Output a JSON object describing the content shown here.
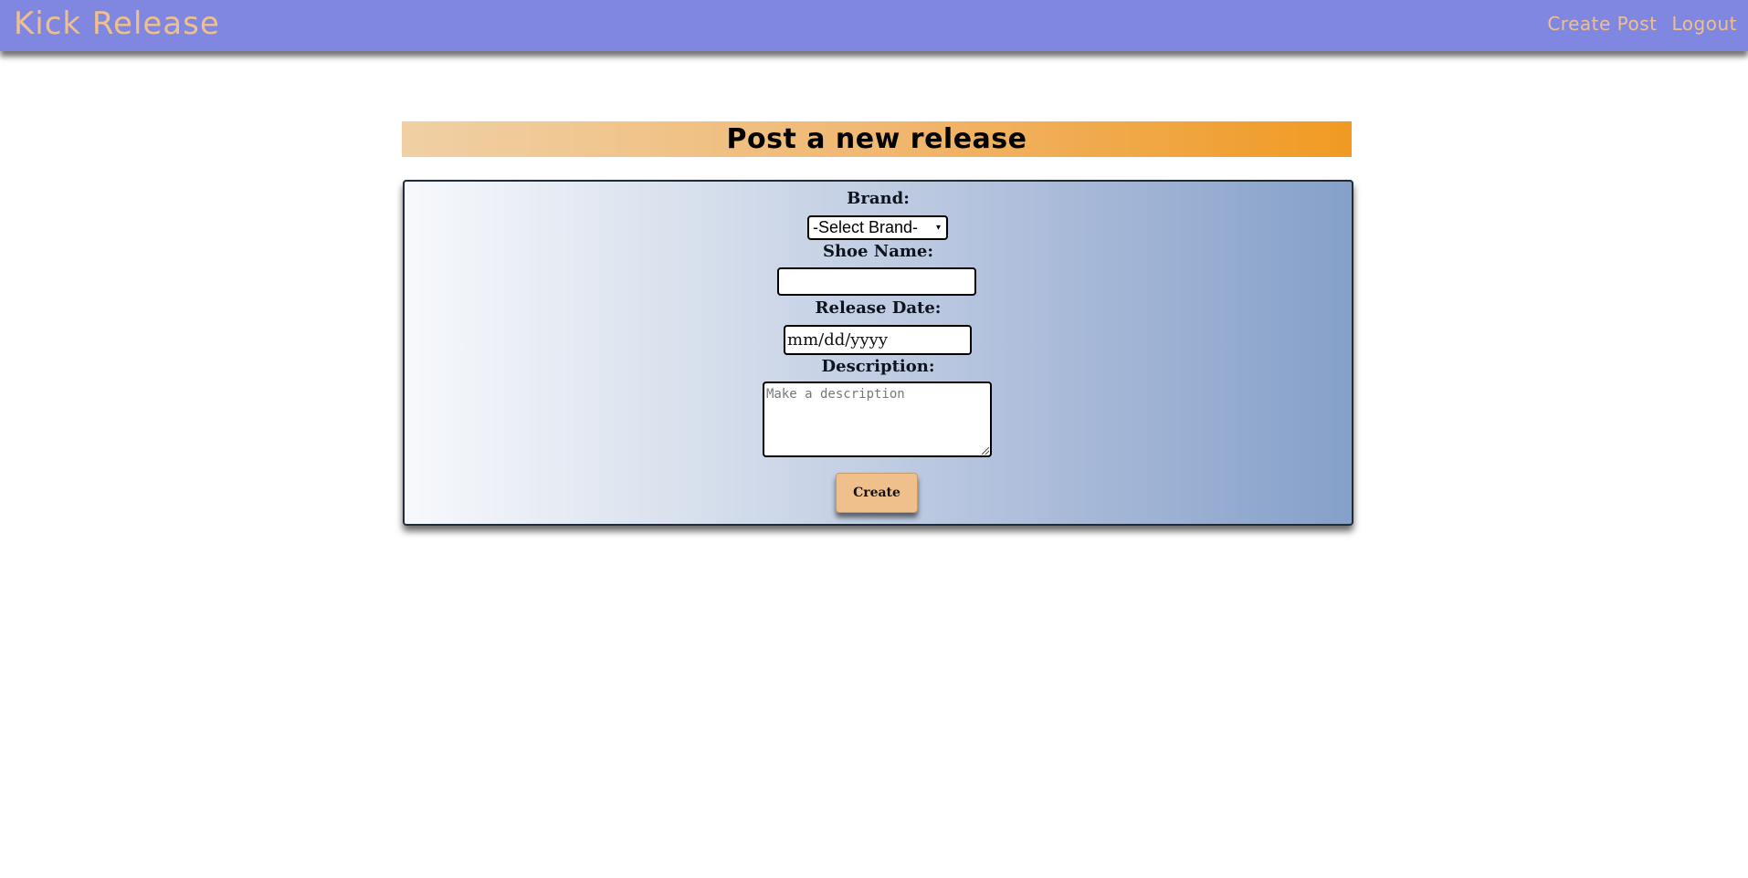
{
  "navbar": {
    "brand": "Kick Release",
    "links": [
      "Create Post",
      "Logout"
    ],
    "background_color": "#8087e0",
    "text_color": "#f0c08c"
  },
  "page": {
    "title": "Post a new release"
  },
  "form": {
    "brand_label": "Brand:",
    "brand_selected": "-Select Brand-",
    "shoe_name_label": "Shoe Name:",
    "shoe_name_value": "",
    "release_date_label": "Release Date:",
    "release_date_placeholder": "mm/dd/yyyy",
    "description_label": "Description:",
    "description_placeholder": "Make a description",
    "submit_label": "Create",
    "button_color": "#f0c08c"
  },
  "icons": {
    "select_caret": "▾"
  }
}
